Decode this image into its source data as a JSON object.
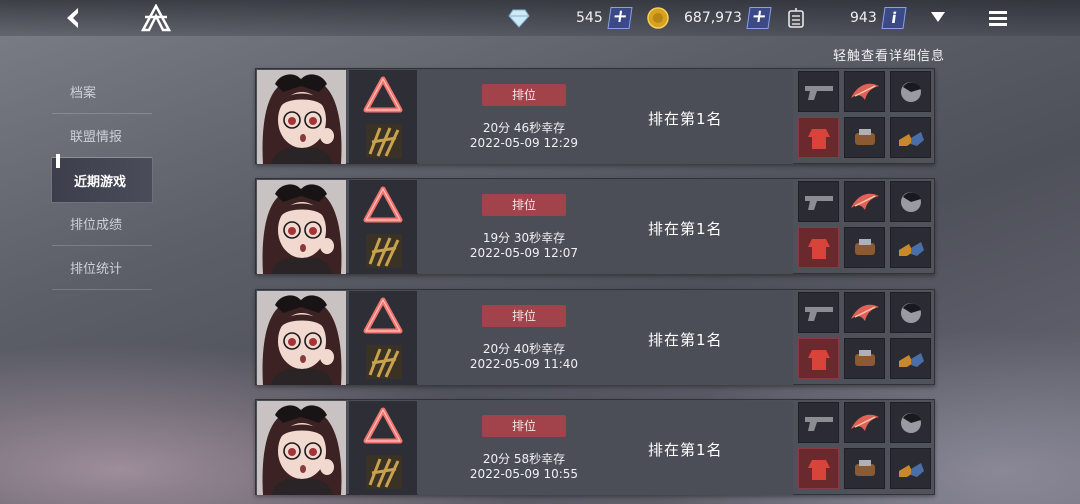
{
  "topbar": {
    "gems": "545",
    "coins": "687,973",
    "credits": "943",
    "plus_label": "+",
    "info_label": "i"
  },
  "hint": "轻触查看详细信息",
  "sidebar": {
    "items": [
      {
        "label": "档案"
      },
      {
        "label": "联盟情报"
      },
      {
        "label": "近期游戏"
      },
      {
        "label": "排位成绩"
      },
      {
        "label": "排位统计"
      }
    ]
  },
  "matches": [
    {
      "mode": "排位",
      "survive": "20分 46秒幸存",
      "date": "2022-05-09 12:29",
      "rank": "排在第1名"
    },
    {
      "mode": "排位",
      "survive": "19分 30秒幸存",
      "date": "2022-05-09 12:07",
      "rank": "排在第1名"
    },
    {
      "mode": "排位",
      "survive": "20分 40秒幸存",
      "date": "2022-05-09 11:40",
      "rank": "排在第1名"
    },
    {
      "mode": "排位",
      "survive": "20分 58秒幸存",
      "date": "2022-05-09 10:55",
      "rank": "排在第1名"
    }
  ],
  "icons": {
    "back": "back-arrow-icon",
    "logo": "eternal-return-logo-icon",
    "gem": "crystal-icon",
    "coin": "gold-coin-icon",
    "credit": "credit-icon",
    "dropdown": "triangle-down-icon",
    "menu": "hamburger-menu-icon"
  },
  "colors": {
    "tag_bg": "#a2434c",
    "plus_bg": "#3b4a86",
    "item_red": "#6a2a2d"
  }
}
